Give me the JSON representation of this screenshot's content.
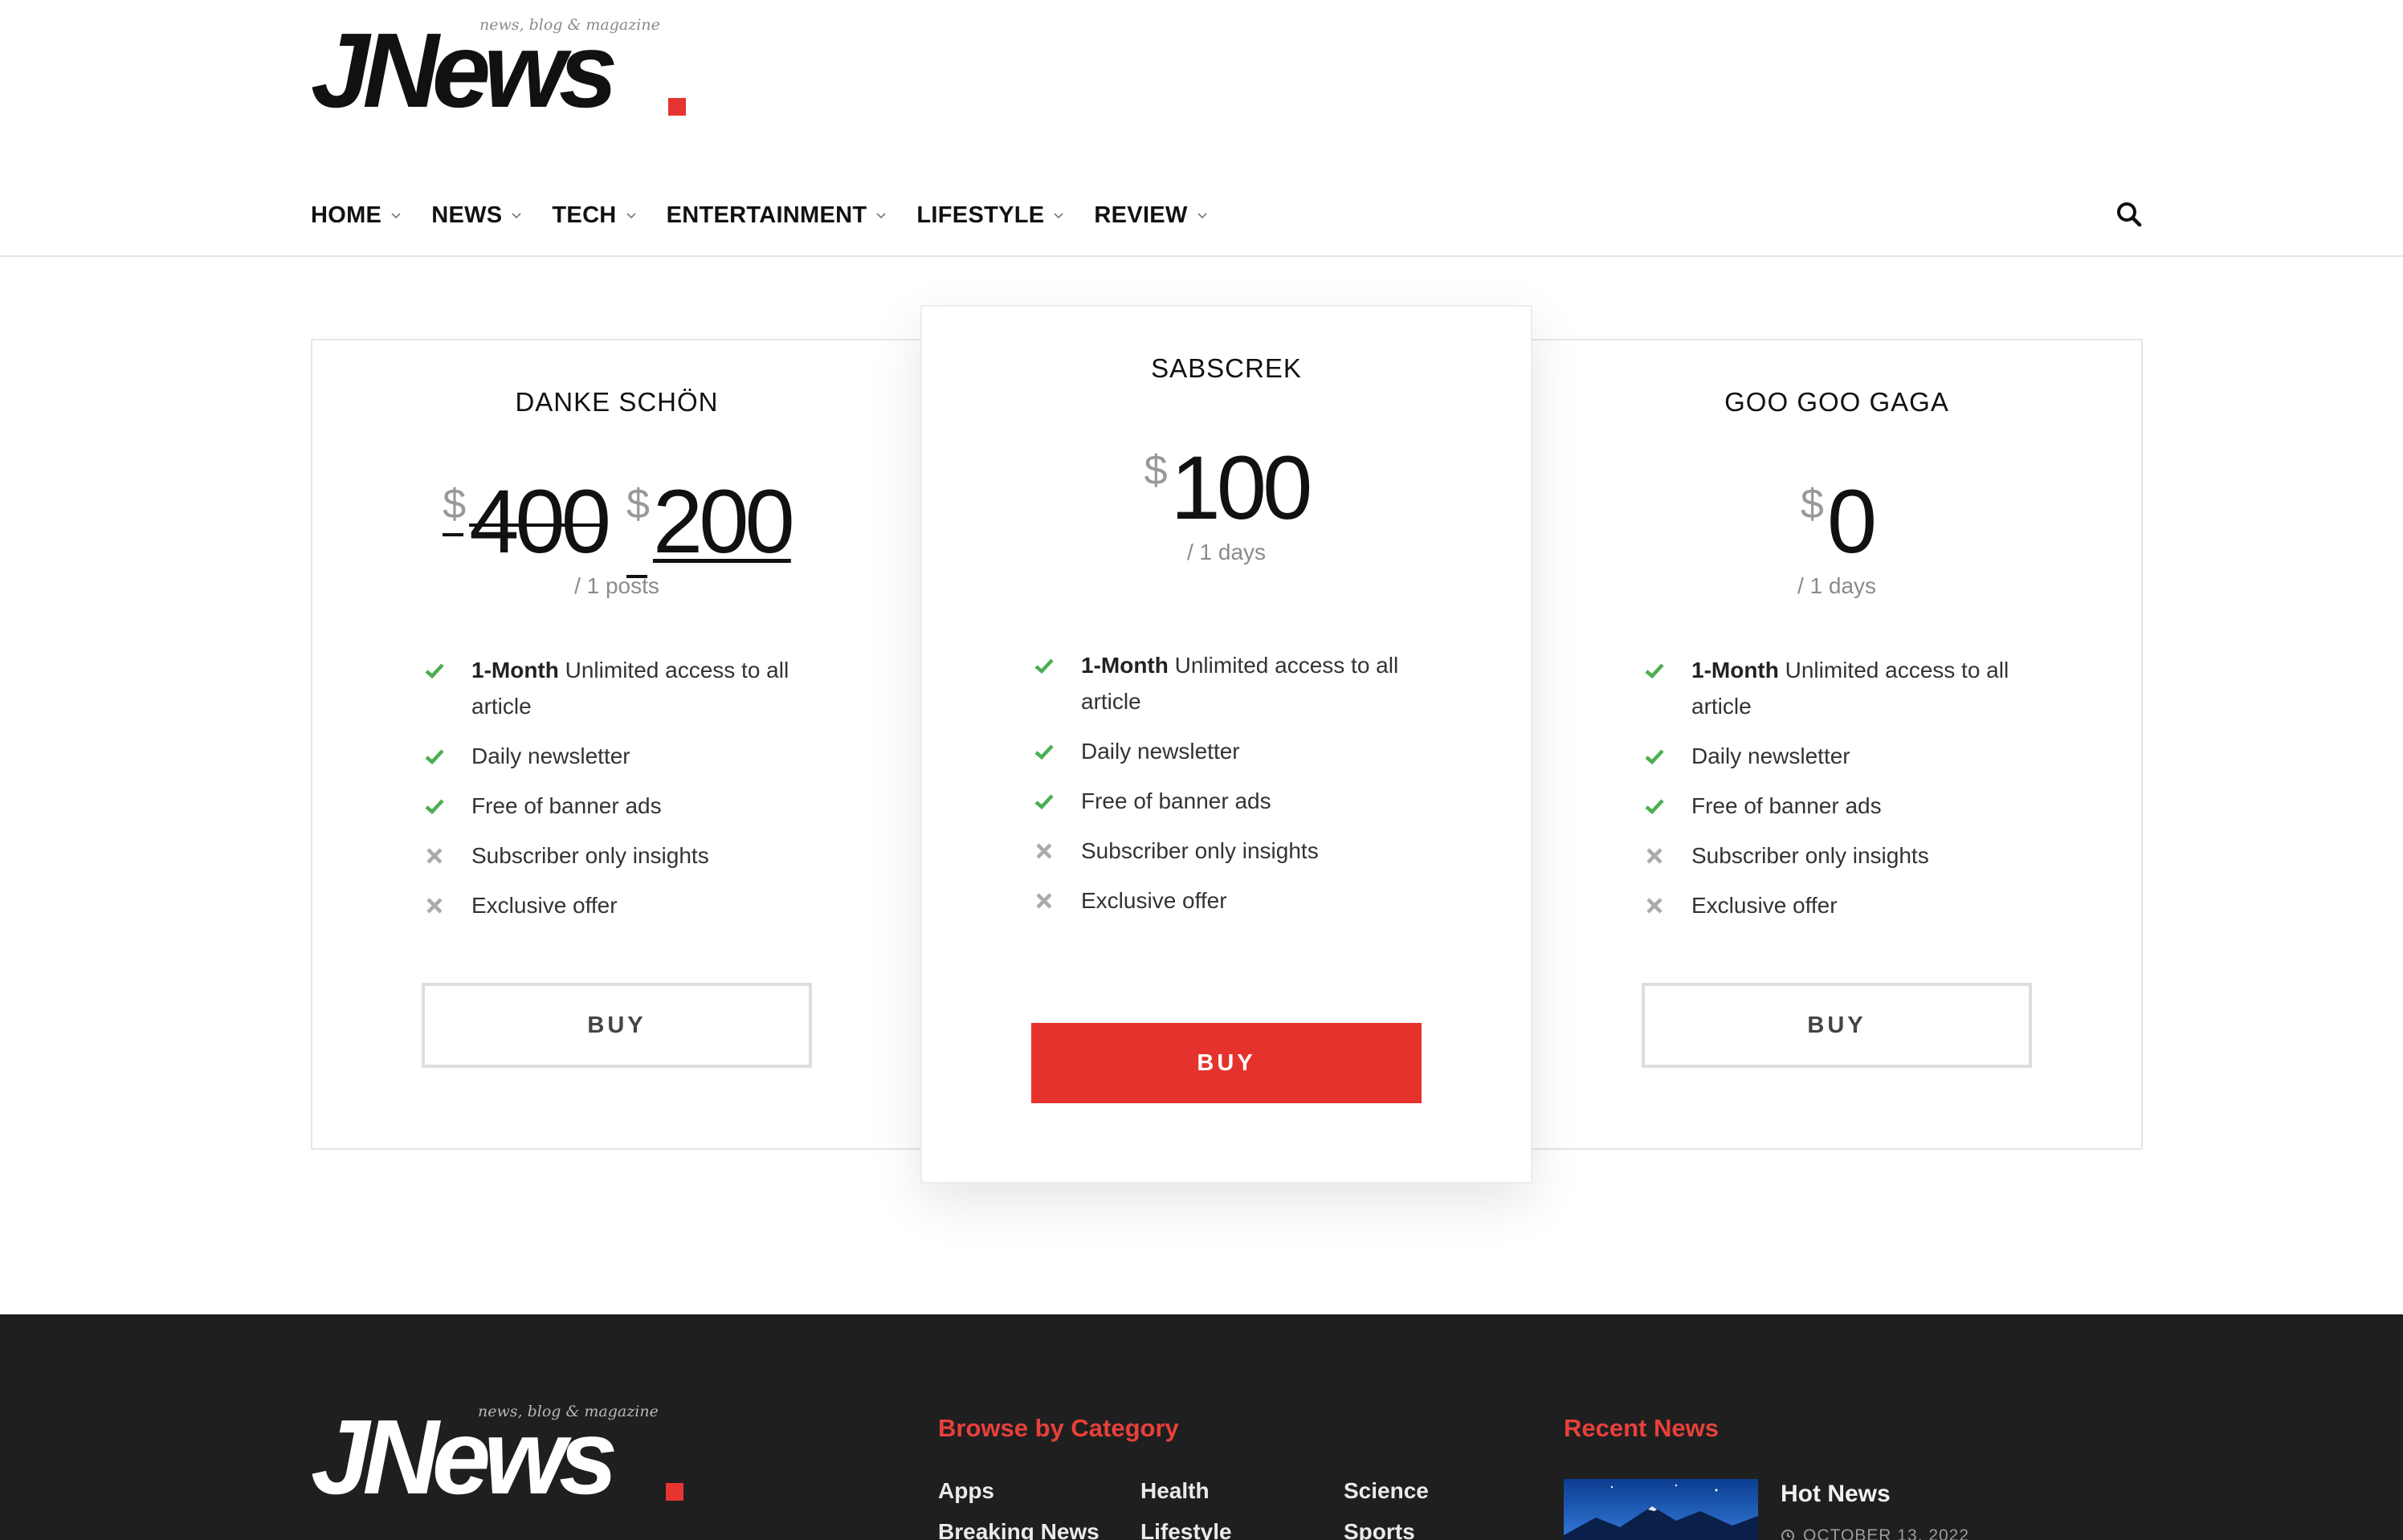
{
  "site": {
    "logo_word": "JNews",
    "tagline": "news, blog & magazine",
    "accent": "#e6322d"
  },
  "nav": {
    "items": [
      {
        "label": "HOME"
      },
      {
        "label": "NEWS"
      },
      {
        "label": "TECH"
      },
      {
        "label": "ENTERTAINMENT"
      },
      {
        "label": "LIFESTYLE"
      },
      {
        "label": "REVIEW"
      }
    ],
    "search_icon": "search-icon"
  },
  "plans": [
    {
      "title": "DANKE SCHÖN",
      "currency": "$",
      "old_price": "400",
      "price": "200",
      "period": "/ 1 posts",
      "features": [
        {
          "bold": "1-Month",
          "text": " Unlimited access to all article",
          "included": true
        },
        {
          "bold": "",
          "text": "Daily newsletter",
          "included": true
        },
        {
          "bold": "",
          "text": "Free of banner ads",
          "included": true
        },
        {
          "bold": "",
          "text": "Subscriber only insights",
          "included": false
        },
        {
          "bold": "",
          "text": "Exclusive offer",
          "included": false
        }
      ],
      "button": "BUY"
    },
    {
      "title": "SABSCREK",
      "currency": "$",
      "price": "100",
      "period": "/ 1 days",
      "features": [
        {
          "bold": "1-Month",
          "text": " Unlimited access to all article",
          "included": true
        },
        {
          "bold": "",
          "text": "Daily newsletter",
          "included": true
        },
        {
          "bold": "",
          "text": "Free of banner ads",
          "included": true
        },
        {
          "bold": "",
          "text": "Subscriber only insights",
          "included": false
        },
        {
          "bold": "",
          "text": "Exclusive offer",
          "included": false
        }
      ],
      "button": "BUY"
    },
    {
      "title": "GOO GOO GAGA",
      "currency": "$",
      "price": "0",
      "period": "/ 1 days",
      "features": [
        {
          "bold": "1-Month",
          "text": " Unlimited access to all article",
          "included": true
        },
        {
          "bold": "",
          "text": "Daily newsletter",
          "included": true
        },
        {
          "bold": "",
          "text": "Free of banner ads",
          "included": true
        },
        {
          "bold": "",
          "text": "Subscriber only insights",
          "included": false
        },
        {
          "bold": "",
          "text": "Exclusive offer",
          "included": false
        }
      ],
      "button": "BUY"
    }
  ],
  "footer": {
    "browse_heading": "Browse by Category",
    "categories": [
      "Apps",
      "Health",
      "Science",
      "Breaking News",
      "Lifestyle",
      "Sports"
    ],
    "recent_heading": "Recent News",
    "recent": [
      {
        "title": "Hot News",
        "date": "OCTOBER 13, 2022"
      }
    ]
  }
}
